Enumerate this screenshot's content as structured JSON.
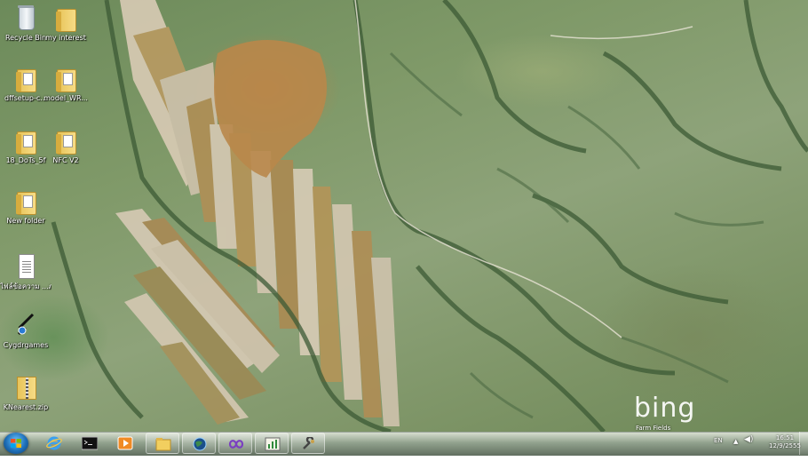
{
  "desktop": {
    "icons": [
      {
        "label": "Recycle Bin",
        "icon": "recycle-bin-icon"
      },
      {
        "label": "my interest",
        "icon": "folder-icon"
      },
      {
        "label": "dffsetup-c...",
        "icon": "folder-icon"
      },
      {
        "label": "model_WR...",
        "icon": "folder-icon"
      },
      {
        "label": "18_DoTs_5f",
        "icon": "folder-icon"
      },
      {
        "label": "NFC V2",
        "icon": "folder-icon"
      },
      {
        "label": "New folder",
        "icon": "folder-icon"
      },
      {
        "label": "ไฟล์ข้อความ ...ภาษาไทย.txt",
        "icon": "text-file-icon"
      },
      {
        "label": "Cygdrgames",
        "icon": "cygwin-icon"
      },
      {
        "label": "KNearest.zip",
        "icon": "zip-folder-icon"
      }
    ]
  },
  "wallpaper": {
    "brand": "bing",
    "caption": "Farm Fields"
  },
  "taskbar": {
    "start_icon": "windows-logo-icon",
    "buttons": [
      {
        "name": "internet-explorer",
        "icon": "internet-explorer-icon",
        "state": "pinned"
      },
      {
        "name": "command-prompt",
        "icon": "command-prompt-icon",
        "state": "pinned"
      },
      {
        "name": "media-player",
        "icon": "media-player-icon",
        "state": "pinned"
      },
      {
        "name": "windows-explorer",
        "icon": "folder-explorer-icon",
        "state": "open"
      },
      {
        "name": "globe-app",
        "icon": "globe-icon",
        "state": "open"
      },
      {
        "name": "visual-studio",
        "icon": "infinity-icon",
        "state": "open"
      },
      {
        "name": "chart-app",
        "icon": "chart-icon",
        "state": "open"
      },
      {
        "name": "tool-app",
        "icon": "wrench-icon",
        "state": "open"
      }
    ],
    "tray": {
      "language": "EN",
      "time": "16:51",
      "date": "12/9/2555"
    }
  },
  "colors": {
    "taskbar": "#5f6f58",
    "start_orb": "#1e6fb8",
    "label_text": "#ffffff"
  }
}
